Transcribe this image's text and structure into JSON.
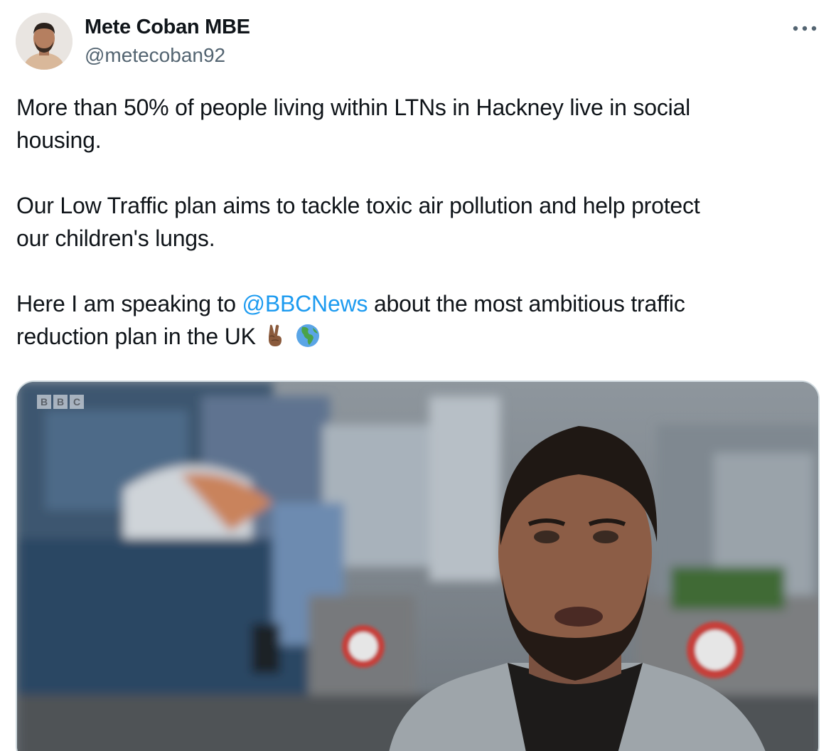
{
  "author": {
    "name": "Mete Coban MBE",
    "handle": "@metecoban92"
  },
  "tweet": {
    "paragraph_1": "More than 50% of people living within LTNs in Hackney live in social\nhousing.",
    "paragraph_2": "Our Low Traffic plan aims to tackle toxic air pollution and help protect\nour children's lungs.",
    "paragraph_3_before": "Here I am speaking to ",
    "mention": "@BBCNews",
    "paragraph_3_after": " about the most ambitious traffic\nreduction plan in the UK",
    "emojis": [
      "victory-hand-medium-dark-skin-emoji",
      "globe-africa-europe-emoji"
    ]
  },
  "media": {
    "type": "video-still",
    "watermark": [
      "B",
      "B",
      "C"
    ]
  },
  "icons": {
    "more": "more-options-icon"
  },
  "colors": {
    "link": "#1d9bf0",
    "secondary_text": "#536471",
    "primary_text": "#0f1419",
    "border": "#cfd9de"
  }
}
